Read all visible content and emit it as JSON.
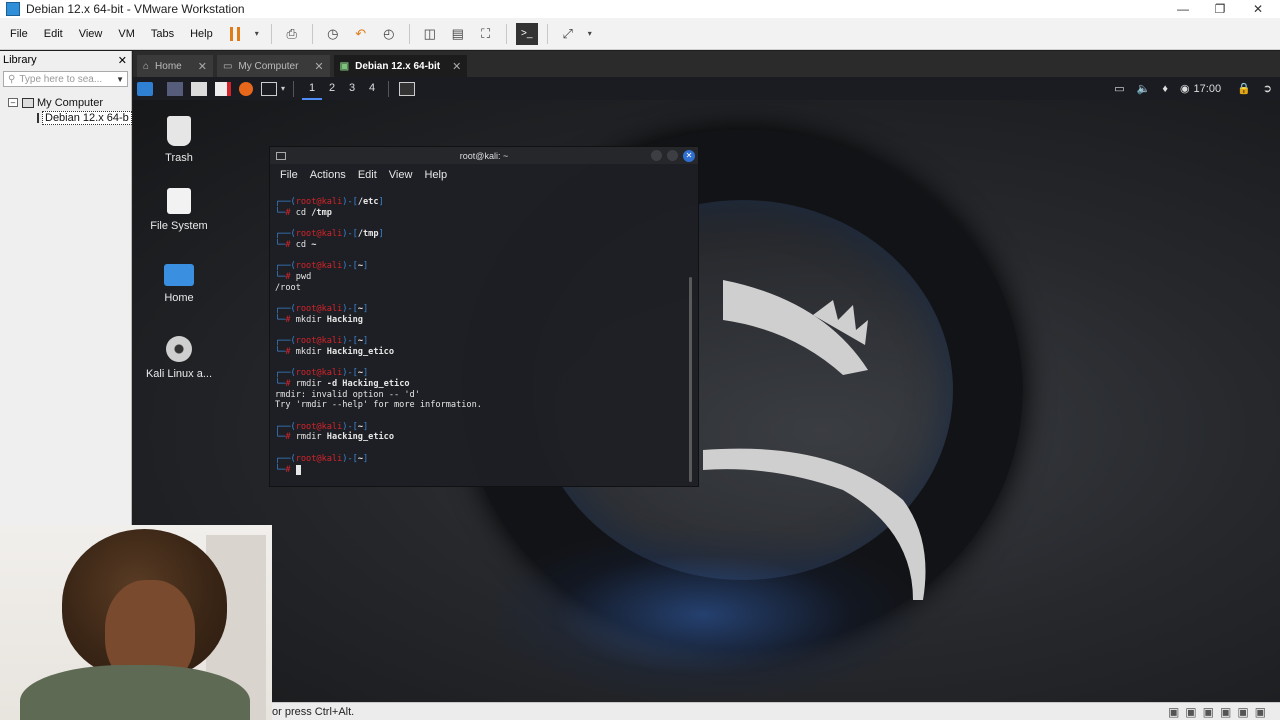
{
  "window": {
    "title": "Debian 12.x 64-bit - VMware Workstation"
  },
  "menubar": {
    "items": [
      "File",
      "Edit",
      "View",
      "VM",
      "Tabs",
      "Help"
    ]
  },
  "library": {
    "title": "Library",
    "search_placeholder": "Type here to sea...",
    "root": "My Computer",
    "vm": "Debian 12.x 64-b"
  },
  "tabs": [
    {
      "label": "Home",
      "icon": "home-icon"
    },
    {
      "label": "My Computer",
      "icon": "monitor-icon"
    },
    {
      "label": "Debian 12.x 64-bit",
      "icon": "vm-icon",
      "active": true
    }
  ],
  "kali_panel": {
    "workspaces": [
      "1",
      "2",
      "3",
      "4"
    ],
    "active_workspace": "1",
    "clock": "17:00"
  },
  "desktop_icons": [
    {
      "label": "Trash",
      "icon": "trash-icon"
    },
    {
      "label": "File System",
      "icon": "drive-icon"
    },
    {
      "label": "Home",
      "icon": "home-folder-icon"
    },
    {
      "label": "Kali Linux a...",
      "icon": "disc-icon"
    }
  ],
  "terminal": {
    "title": "root@kali: ~",
    "menu": [
      "File",
      "Actions",
      "Edit",
      "View",
      "Help"
    ],
    "blocks": [
      {
        "path": "/etc",
        "cmd": "cd /tmp",
        "out": []
      },
      {
        "path": "/tmp",
        "cmd": "cd ~",
        "out": []
      },
      {
        "path": "~",
        "cmd": "pwd",
        "out": [
          "/root"
        ]
      },
      {
        "path": "~",
        "cmd": "mkdir Hacking",
        "out": []
      },
      {
        "path": "~",
        "cmd": "mkdir Hacking_etico",
        "out": []
      },
      {
        "path": "~",
        "cmd": "rmdir -d Hacking_etico",
        "out": [
          "rmdir: invalid option -- 'd'",
          "Try 'rmdir --help' for more information."
        ]
      },
      {
        "path": "~",
        "cmd": "rmdir Hacking_etico",
        "out": []
      },
      {
        "path": "~",
        "cmd": "",
        "out": []
      }
    ],
    "prompt_user": "root@kali"
  },
  "status": {
    "text": "or press Ctrl+Alt."
  },
  "colors": {
    "prompt_user": "#d2242a",
    "prompt_frame": "#3a86d6",
    "accent": "#4f8ef7",
    "pause": "#e07b1a"
  }
}
